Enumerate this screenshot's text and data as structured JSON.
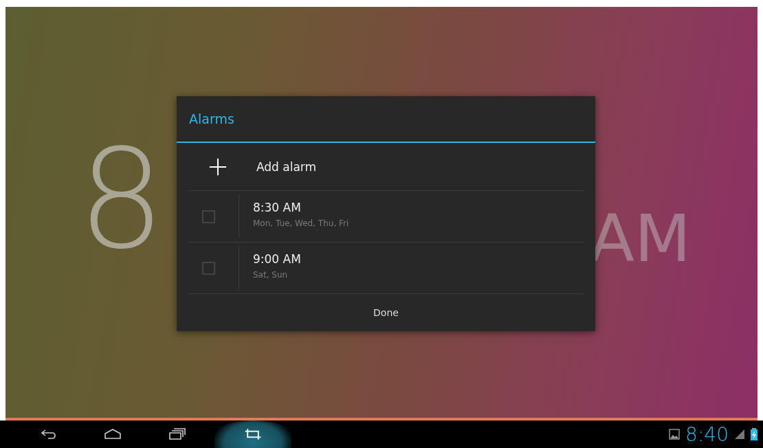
{
  "clock_widget": {
    "hour": "8",
    "suffix": "AM"
  },
  "dialog": {
    "title": "Alarms",
    "add_item": {
      "label": "Add alarm"
    },
    "alarms": [
      {
        "time": "8:30 AM",
        "days": "Mon, Tue, Wed, Thu, Fri",
        "checked": false
      },
      {
        "time": "9:00 AM",
        "days": "Sat, Sun",
        "checked": false
      }
    ],
    "done_button": "Done"
  },
  "nav_bar": {
    "buttons": [
      {
        "kind": "back",
        "selected": false
      },
      {
        "kind": "home",
        "selected": false
      },
      {
        "kind": "recents",
        "selected": false
      },
      {
        "kind": "screenshot",
        "selected": true
      }
    ],
    "time": "8:40"
  }
}
